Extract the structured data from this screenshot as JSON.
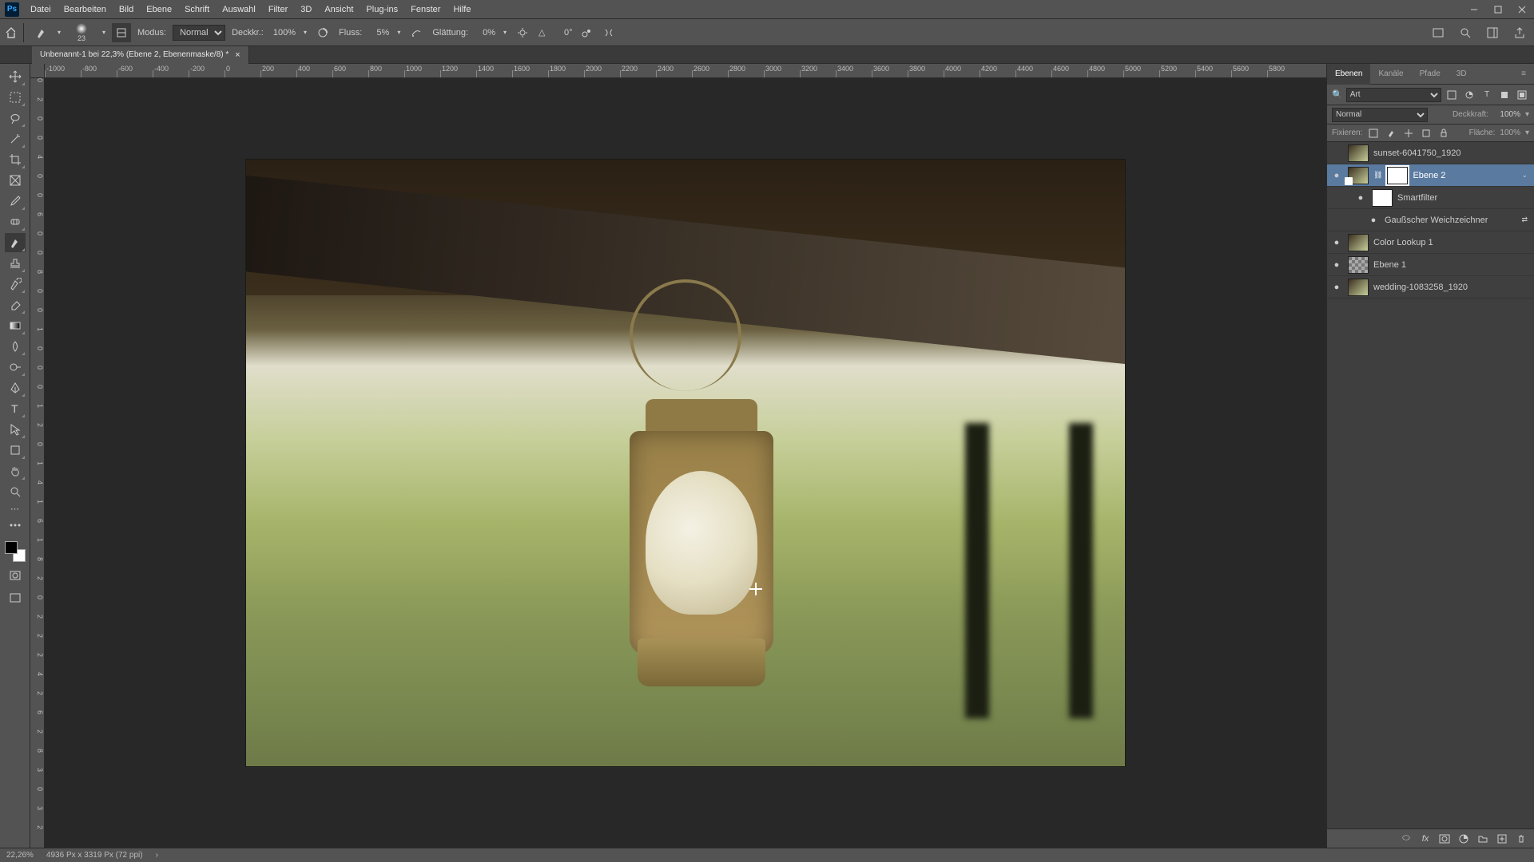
{
  "menubar": {
    "items": [
      "Datei",
      "Bearbeiten",
      "Bild",
      "Ebene",
      "Schrift",
      "Auswahl",
      "Filter",
      "3D",
      "Ansicht",
      "Plug-ins",
      "Fenster",
      "Hilfe"
    ]
  },
  "optionsbar": {
    "brush_size": "23",
    "modus_label": "Modus:",
    "modus_value": "Normal",
    "deckkraft_label": "Deckkr.:",
    "deckkraft_value": "100%",
    "fluss_label": "Fluss:",
    "fluss_value": "5%",
    "glattung_label": "Glättung:",
    "glattung_value": "0%",
    "angle_icon_label": "△",
    "angle_value": "0°"
  },
  "tab": {
    "title": "Unbenannt-1 bei 22,3% (Ebene 2, Ebenenmaske/8) *"
  },
  "ruler_h": [
    "-1000",
    "-800",
    "-600",
    "-400",
    "-200",
    "0",
    "200",
    "400",
    "600",
    "800",
    "1000",
    "1200",
    "1400",
    "1600",
    "1800",
    "2000",
    "2200",
    "2400",
    "2600",
    "2800",
    "3000",
    "3200",
    "3400",
    "3600",
    "3800",
    "4000",
    "4200",
    "4400",
    "4600",
    "4800",
    "5000",
    "5200",
    "5400",
    "5600",
    "5800"
  ],
  "ruler_v": [
    "0",
    "2",
    "0",
    "0",
    "4",
    "0",
    "0",
    "6",
    "0",
    "0",
    "8",
    "0",
    "0",
    "1",
    "0",
    "0",
    "0",
    "1",
    "2",
    "0",
    "1",
    "4",
    "1",
    "6",
    "1",
    "8",
    "2",
    "0",
    "2",
    "2",
    "2",
    "4",
    "2",
    "6",
    "2",
    "8",
    "3",
    "0",
    "3",
    "2"
  ],
  "panel": {
    "tabs": [
      "Ebenen",
      "Kanäle",
      "Pfade",
      "3D"
    ],
    "search_kind": "Art",
    "blend_mode": "Normal",
    "opacity_label": "Deckkraft:",
    "opacity_value": "100%",
    "lock_label": "Fixieren:",
    "fill_label": "Fläche:",
    "fill_value": "100%"
  },
  "layers": [
    {
      "eye": "",
      "name": "sunset-6041750_1920",
      "selected": false,
      "thumb": "photo"
    },
    {
      "eye": "●",
      "name": "Ebene 2",
      "selected": true,
      "thumb": "smart",
      "mask": true,
      "fx": "⌄"
    },
    {
      "eye": "●",
      "name": "Smartfilter",
      "indent": 1,
      "thumb": "mask"
    },
    {
      "eye": "●",
      "name": "Gaußscher Weichzeichner",
      "indent": 2,
      "fx": "⇄"
    },
    {
      "eye": "●",
      "name": "Color Lookup 1",
      "thumb": "photo",
      "mask": false
    },
    {
      "eye": "●",
      "name": "Ebene 1",
      "thumb": "checker"
    },
    {
      "eye": "●",
      "name": "wedding-1083258_1920",
      "thumb": "photo"
    }
  ],
  "statusbar": {
    "zoom": "22,26%",
    "info": "4936 Px x 3319 Px (72 ppi)"
  }
}
